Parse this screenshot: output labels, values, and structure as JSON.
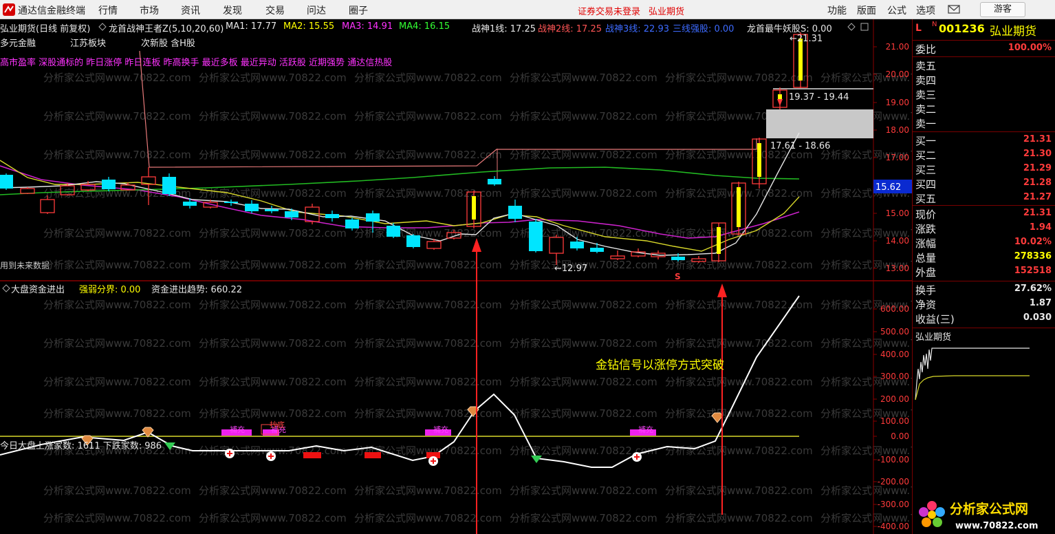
{
  "menubar": {
    "title": "通达信金融终端",
    "items": [
      "行情",
      "市场",
      "资讯",
      "发现",
      "交易",
      "问达",
      "圈子"
    ],
    "warning": "证券交易未登录",
    "broker": "弘业期货",
    "right_items": [
      "功能",
      "版面",
      "公式",
      "选项"
    ],
    "guest_button": "游客"
  },
  "header": {
    "stock": "弘业期货(日线 前复权)",
    "indicator": "龙首战神王者Z(5,10,20,60)",
    "ma1": "MA1: 17.77",
    "ma2": "MA2: 15.55",
    "ma3": "MA3: 14.91",
    "ma4": "MA4: 16.15",
    "zs1": "战神1线: 17.25",
    "zs2": "战神2线: 17.25",
    "zs3": "战神3线: 22.93",
    "sanxian": "三线强股: 0.00",
    "longshou": "龙首最牛妖股S: 0.00",
    "tag1": "多元金融",
    "tag2": "江苏板块",
    "tag3": "次新股 含H股",
    "concepts": "高市盈率 深股通标的 昨日涨停 昨日连板 昨高换手 最近多板 最近异动 活跃股 近期强势 通达信热股",
    "future_data": "用到未来数据"
  },
  "upper_chart": {
    "price_axis": [
      "21.00",
      "20.00",
      "19.00",
      "18.00",
      "17.00",
      "16.00",
      "15.00",
      "14.00",
      "13.00"
    ],
    "current_price_tag": "15.62",
    "label_high": "21.31",
    "label_low": "12.97",
    "range1": "19.37 - 19.44",
    "range2": "17.61 - 18.66",
    "s_mark": "S",
    "colors": {
      "up": "#ff3b3b",
      "down": "#00e5ff",
      "yellow": "#ffff00",
      "ma_white": "#e6e6e6",
      "ma_yellow": "#d9d92a",
      "ma_magenta": "#cc22cc",
      "ma_green": "#22cc22",
      "salmon": "#e87a7a"
    }
  },
  "lower_chart": {
    "indicator": "大盘资金进出",
    "strong_weak": "强弱分界: 0.00",
    "trend": "资金进出趋势: 660.22",
    "axis": [
      "600.00",
      "500.00",
      "400.00",
      "300.00",
      "200.00",
      "100.00",
      "0.00",
      "-100.00",
      "-200.00",
      "-300.00",
      "-400.00"
    ],
    "up_down_text": "今日大盘上涨家数: 1611 下跌家数: 986",
    "annotation": "金钻信号以涨停方式突破",
    "labels": {
      "bu": "補充",
      "cd": "抄底"
    }
  },
  "right_panel": {
    "code": "001236",
    "name": "弘业期货",
    "flag_l": "L",
    "flag_n": "N",
    "weibi_label": "委比",
    "weibi_value": "100.00%",
    "sells": [
      "卖五",
      "卖四",
      "卖三",
      "卖二",
      "卖一"
    ],
    "buys": [
      {
        "label": "买一",
        "value": "21.31"
      },
      {
        "label": "买二",
        "value": "21.30"
      },
      {
        "label": "买三",
        "value": "21.29"
      },
      {
        "label": "买四",
        "value": "21.28"
      },
      {
        "label": "买五",
        "value": "21.27"
      }
    ],
    "stats1": [
      {
        "label": "现价",
        "value": "21.31",
        "color": "#ff3b3b"
      },
      {
        "label": "涨跌",
        "value": "1.94",
        "color": "#ff3b3b"
      },
      {
        "label": "涨幅",
        "value": "10.02%",
        "color": "#ff3b3b"
      },
      {
        "label": "总量",
        "value": "278336",
        "color": "#ffff00"
      },
      {
        "label": "外盘",
        "value": "152518",
        "color": "#ff3b3b"
      }
    ],
    "stats2": [
      {
        "label": "换手",
        "value": "27.62%",
        "color": "#e8e8e8"
      },
      {
        "label": "净资",
        "value": "1.87",
        "color": "#e8e8e8"
      },
      {
        "label": "收益(三)",
        "value": "0.030",
        "color": "#e8e8e8"
      }
    ],
    "mini_chart_title": "弘业期货",
    "watermark_brand": "分析家公式网",
    "watermark_url": "www.70822.com"
  }
}
